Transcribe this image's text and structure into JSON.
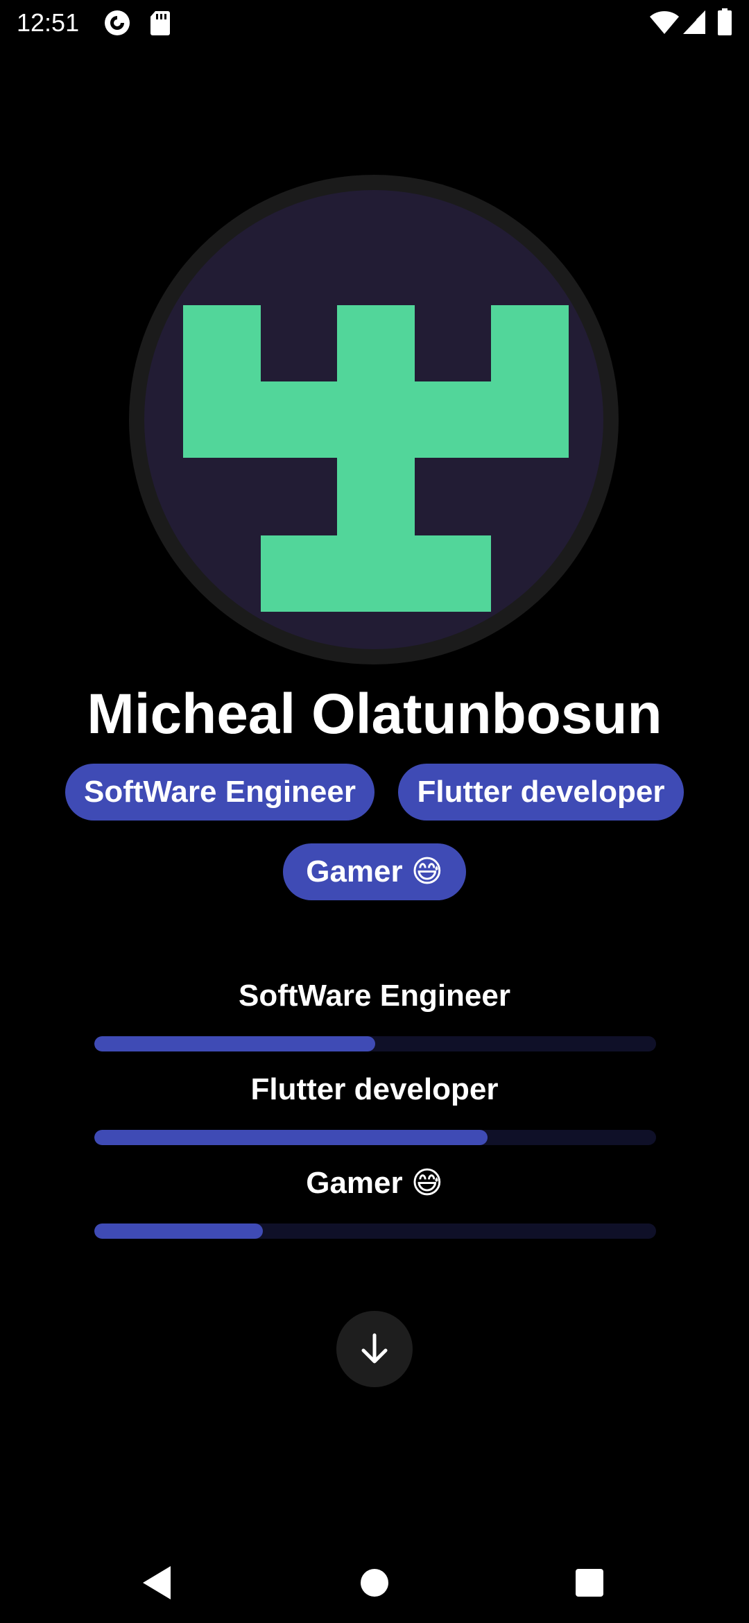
{
  "status_bar": {
    "time": "12:51",
    "icons": [
      "pocket-casts-icon",
      "sd-card-icon",
      "wifi-icon",
      "signal-icon",
      "battery-icon"
    ]
  },
  "profile": {
    "avatar_icon": "tower-identicon",
    "avatar_color": "#52d69a",
    "avatar_background": "#221c34",
    "name": "Micheal Olatunbosun"
  },
  "chips": [
    {
      "label": "SoftWare Engineer"
    },
    {
      "label": "Flutter developer"
    },
    {
      "label": "Gamer 😅"
    }
  ],
  "skills": [
    {
      "label": "SoftWare Engineer",
      "progress": 0.5
    },
    {
      "label": "Flutter developer",
      "progress": 0.7
    },
    {
      "label": "Gamer 😅",
      "progress": 0.3
    }
  ],
  "fab": {
    "icon": "arrow-down-icon"
  },
  "nav_bar": {
    "icons": [
      "back-icon",
      "home-icon",
      "recents-icon"
    ]
  },
  "colors": {
    "accent": "#3f4bb5",
    "track": "#0f1028",
    "background": "#000000"
  }
}
